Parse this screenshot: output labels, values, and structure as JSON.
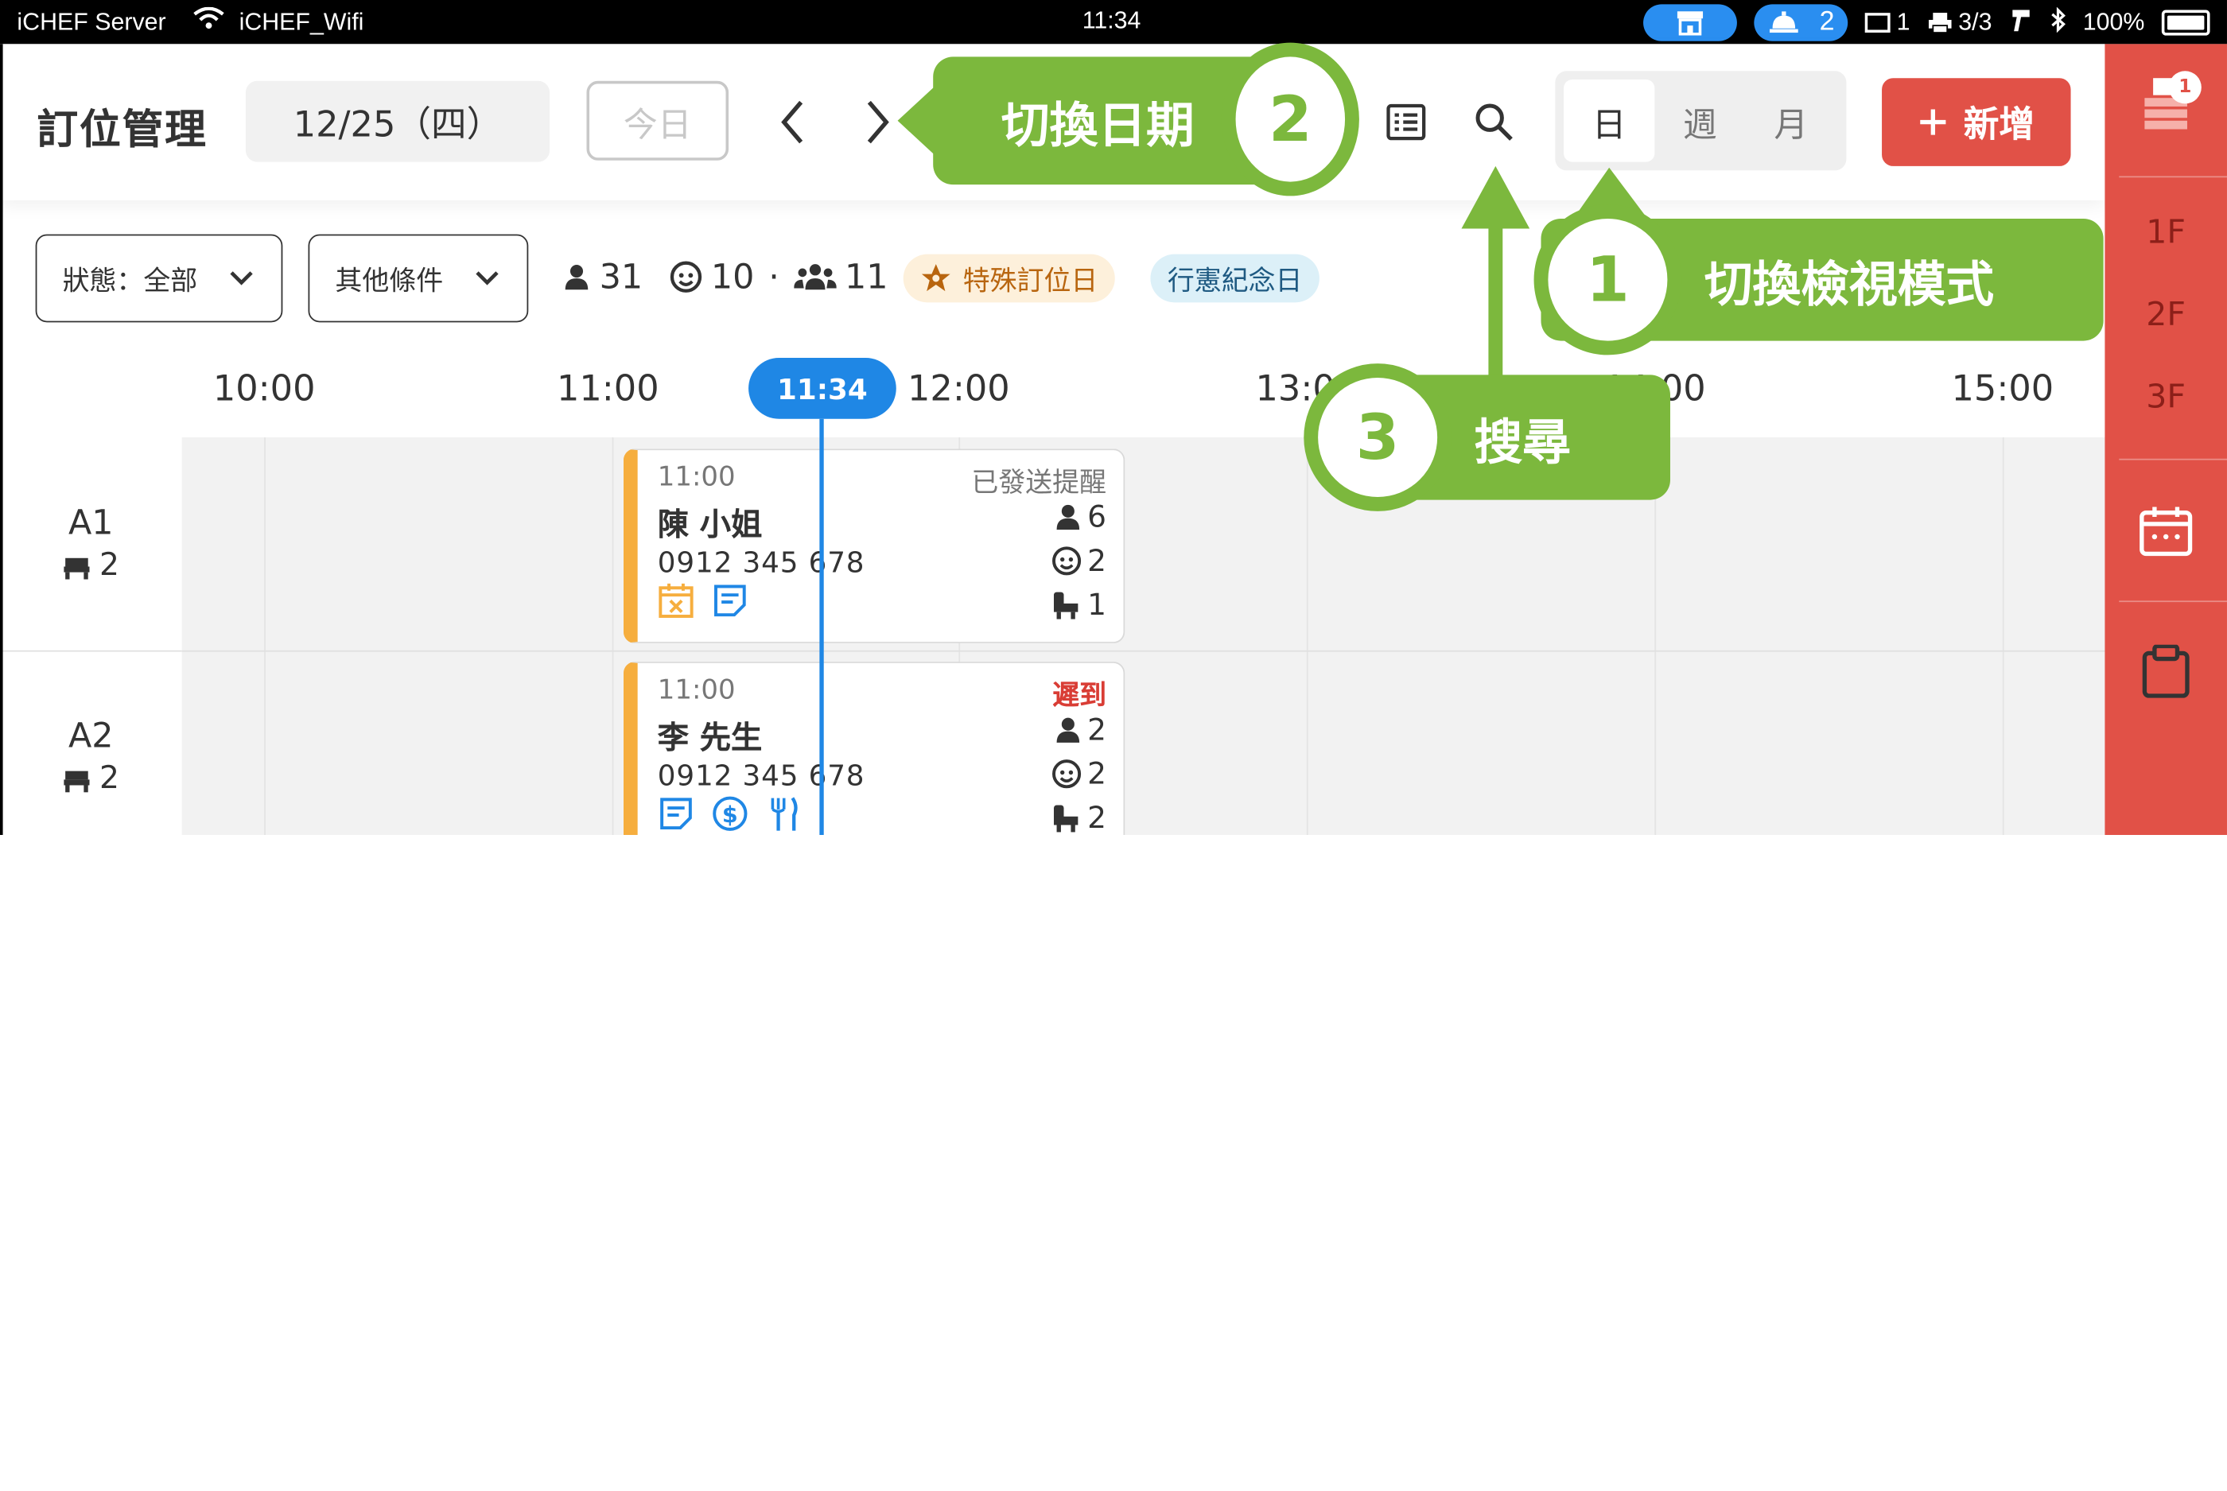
{
  "status_bar": {
    "server": "iCHEF Server",
    "wifi": "iCHEF_Wifi",
    "time": "11:34",
    "bell_count": "2",
    "tablet_count": "1",
    "printer_count": "3/3",
    "battery": "100%"
  },
  "header": {
    "title": "訂位管理",
    "date": "12/25（四）",
    "today_label": "今日",
    "view_options": [
      "日",
      "週",
      "月"
    ],
    "active_view": "日",
    "add_label": "新增"
  },
  "filters": {
    "status_label": "狀態：全部",
    "other_label": "其他條件"
  },
  "stats": {
    "guests": "31",
    "kids": "10",
    "sep": "·",
    "groups": "11"
  },
  "tags": {
    "special_day": "特殊訂位日",
    "holiday": "行憲紀念日"
  },
  "timeline": {
    "hours": [
      "10:00",
      "11:00",
      "12:00",
      "13:00",
      "14:00",
      "15:00"
    ],
    "now": "11:34"
  },
  "tables": [
    {
      "name": "A1",
      "seats": "2"
    },
    {
      "name": "A2",
      "seats": "2"
    }
  ],
  "reservations": [
    {
      "time": "11:00",
      "status": "已發送提醒",
      "name": "陳 小姐",
      "phone": "0912 345 678",
      "adults": "6",
      "kids": "2",
      "high_chairs": "1"
    },
    {
      "time": "11:00",
      "status": "遲到",
      "name": "李 先生",
      "phone": "0912 345 678",
      "adults": "2",
      "kids": "2",
      "high_chairs": "2"
    }
  ],
  "sidebar": {
    "notification_count": "1",
    "floors": [
      "1F",
      "2F",
      "3F"
    ]
  },
  "callouts": {
    "view_mode": {
      "number": "1",
      "text": "切換檢視模式"
    },
    "change_date": {
      "number": "2",
      "text": "切換日期"
    },
    "search": {
      "number": "3",
      "text": "搜尋"
    }
  },
  "colors": {
    "accent_blue": "#1f87e5",
    "brand_red": "#e15147",
    "callout_green": "#7cb83d",
    "card_orange": "#f6ae3e",
    "late_red": "#d93d35"
  }
}
